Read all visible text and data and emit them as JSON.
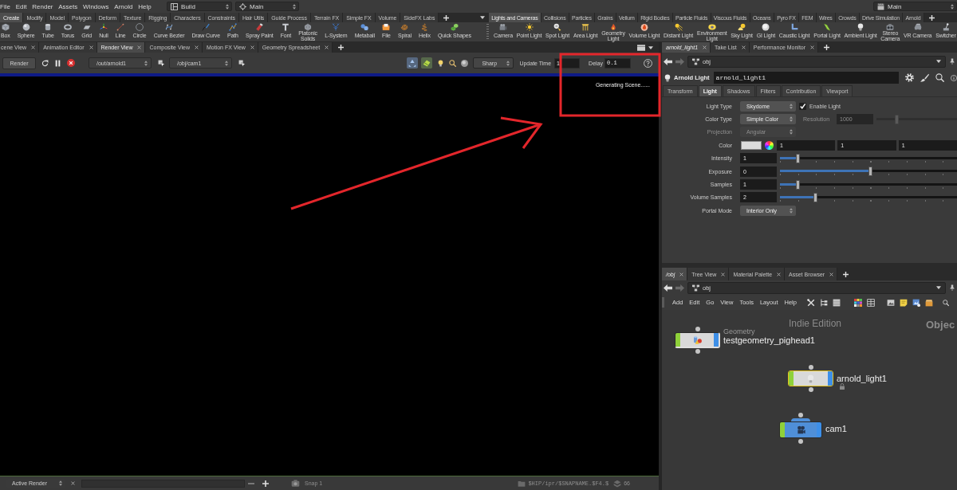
{
  "menu_bar": {
    "items": [
      "File",
      "Edit",
      "Render",
      "Assets",
      "Windows",
      "Arnold",
      "Help"
    ],
    "dropdowns": [
      "Build",
      "Main",
      "Main"
    ]
  },
  "shelf_left": {
    "tabs": [
      {
        "label": "Create",
        "selected": true
      },
      {
        "label": "Modify",
        "selected": false
      },
      {
        "label": "Model",
        "selected": false
      },
      {
        "label": "Polygon",
        "selected": false
      },
      {
        "label": "Deform",
        "selected": false
      },
      {
        "label": "Texture",
        "selected": false
      },
      {
        "label": "Rigging",
        "selected": false
      },
      {
        "label": "Characters",
        "selected": false
      },
      {
        "label": "Constraints",
        "selected": false
      },
      {
        "label": "Hair Utils",
        "selected": false
      },
      {
        "label": "Guide Process",
        "selected": false
      },
      {
        "label": "Terrain FX",
        "selected": false
      },
      {
        "label": "Simple FX",
        "selected": false
      },
      {
        "label": "Volume",
        "selected": false
      },
      {
        "label": "SideFX Labs",
        "selected": false
      }
    ],
    "tools": [
      "Box",
      "Sphere",
      "Tube",
      "Torus",
      "Grid",
      "Null",
      "Line",
      "Circle",
      "Curve Bezier",
      "Draw Curve",
      "Path",
      "Spray Paint",
      "Font",
      "Platonic Solids",
      "L-System",
      "Metaball",
      "File",
      "Spiral",
      "Helix",
      "Quick Shapes"
    ]
  },
  "shelf_right": {
    "tabs": [
      {
        "label": "Lights and Cameras",
        "selected": true
      },
      {
        "label": "Collisions",
        "selected": false
      },
      {
        "label": "Particles",
        "selected": false
      },
      {
        "label": "Grains",
        "selected": false
      },
      {
        "label": "Vellum",
        "selected": false
      },
      {
        "label": "Rigid Bodies",
        "selected": false
      },
      {
        "label": "Particle Fluids",
        "selected": false
      },
      {
        "label": "Viscous Fluids",
        "selected": false
      },
      {
        "label": "Oceans",
        "selected": false
      },
      {
        "label": "Pyro FX",
        "selected": false
      },
      {
        "label": "FEM",
        "selected": false
      },
      {
        "label": "Wires",
        "selected": false
      },
      {
        "label": "Crowds",
        "selected": false
      },
      {
        "label": "Drive Simulation",
        "selected": false
      },
      {
        "label": "Arnold",
        "selected": false
      }
    ],
    "tools": [
      "Camera",
      "Point Light",
      "Spot Light",
      "Area Light",
      "Geometry Light",
      "Volume Light",
      "Distant Light",
      "Environment Light",
      "Sky Light",
      "GI Light",
      "Caustic Light",
      "Portal Light",
      "Ambient Light",
      "Stereo Camera",
      "VR Camera",
      "Switcher"
    ]
  },
  "render_pane": {
    "tabs": [
      {
        "label": "cene View",
        "selected": false
      },
      {
        "label": "Animation Editor",
        "selected": false
      },
      {
        "label": "Render View",
        "selected": true
      },
      {
        "label": "Composite View",
        "selected": false
      },
      {
        "label": "Motion FX View",
        "selected": false
      },
      {
        "label": "Geometry Spreadsheet",
        "selected": false
      }
    ],
    "render_button": "Render",
    "output_node": "/out/arnold1",
    "camera": "/obj/cam1",
    "preview_mode": "Sharp",
    "update_time_label": "Update Time",
    "update_time": "1",
    "delay_label": "Delay",
    "delay": "0.1",
    "status": "Generating Scene......",
    "snapshot": "Active Render",
    "snap": "Snap 1",
    "snapshot_path": "$HIP/ipr/$SNAPNAME.$F4.$",
    "snapshot_count": "66"
  },
  "parameter_pane": {
    "tabs": [
      {
        "label": "arnold_light1",
        "selected": true
      },
      {
        "label": "Take List",
        "selected": false
      },
      {
        "label": "Performance Monitor",
        "selected": false
      }
    ],
    "path": "obj",
    "node_type": "Arnold Light",
    "node_name": "arnold_light1",
    "param_tabs": [
      {
        "label": "Transform",
        "selected": false
      },
      {
        "label": "Light",
        "selected": true
      },
      {
        "label": "Shadows",
        "selected": false
      },
      {
        "label": "Filters",
        "selected": false
      },
      {
        "label": "Contribution",
        "selected": false
      },
      {
        "label": "Viewport",
        "selected": false
      }
    ],
    "params": [
      {
        "kind": "menu",
        "label": "Light Type",
        "value": "Skydome",
        "disabled": false,
        "toggle": {
          "label": "Enable Light",
          "checked": true
        }
      },
      {
        "kind": "menu",
        "label": "Color Type",
        "value": "Simple Color",
        "disabled": false,
        "extra": {
          "label": "Resolution",
          "value": "1000",
          "level": 0.25,
          "disabled": true
        }
      },
      {
        "kind": "menu",
        "label": "Projection",
        "value": "Angular",
        "disabled": true
      },
      {
        "kind": "color",
        "label": "Color",
        "values": [
          "1",
          "1",
          "1"
        ],
        "disabled": false
      },
      {
        "kind": "slider",
        "label": "Intensity",
        "value": "1",
        "level": 0.1,
        "disabled": false
      },
      {
        "kind": "slider",
        "label": "Exposure",
        "value": "0",
        "level": 0.51,
        "disabled": false
      },
      {
        "kind": "slider",
        "label": "Samples",
        "value": "1",
        "level": 0.1,
        "disabled": false
      },
      {
        "kind": "slider",
        "label": "Volume Samples",
        "value": "2",
        "level": 0.2,
        "disabled": false
      },
      {
        "kind": "menu",
        "label": "Portal Mode",
        "value": "Interior Only",
        "disabled": false
      }
    ]
  },
  "network_pane": {
    "tabs": [
      {
        "label": "/obj",
        "selected": true
      },
      {
        "label": "Tree View",
        "selected": false
      },
      {
        "label": "Material Palette",
        "selected": false
      },
      {
        "label": "Asset Browser",
        "selected": false
      }
    ],
    "path": "obj",
    "menu": [
      "Add",
      "Edit",
      "Go",
      "View",
      "Tools",
      "Layout",
      "Help"
    ],
    "edition": "Indie Edition",
    "context": "Objec",
    "nodes": [
      {
        "kind": "geometry",
        "type_label": "Geometry",
        "name": "testgeometry_pighead1",
        "selected": false,
        "locked": false
      },
      {
        "kind": "light",
        "name": "arnold_light1",
        "selected": true,
        "locked": true
      },
      {
        "kind": "camera",
        "name": "cam1",
        "selected": false,
        "locked": false
      }
    ]
  }
}
